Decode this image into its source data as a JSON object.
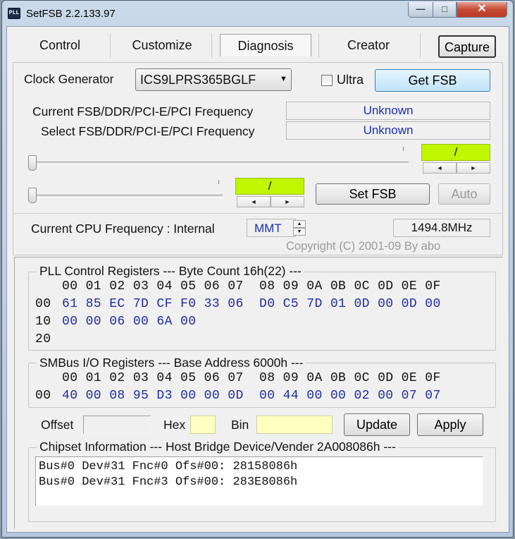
{
  "window": {
    "app_icon_text": "PLL",
    "title": "SetFSB 2.2.133.97",
    "min_glyph": "—",
    "max_glyph": "□",
    "close_glyph": "✕"
  },
  "tabs": [
    {
      "label": "Control"
    },
    {
      "label": "Customize"
    },
    {
      "label": "Diagnosis",
      "selected": true
    },
    {
      "label": "Creator"
    }
  ],
  "capture_label": "Capture",
  "clock": {
    "label": "Clock Generator",
    "selected": "ICS9LPRS365BGLF",
    "ultra_label": "Ultra",
    "ultra_checked": false,
    "get_fsb_label": "Get FSB"
  },
  "freq": {
    "current_label": "Current FSB/DDR/PCI-E/PCI Frequency",
    "current_value": "Unknown",
    "select_label": "Select FSB/DDR/PCI-E/PCI Frequency",
    "select_value": "Unknown"
  },
  "slider1": {
    "value_text": "/",
    "level": 0
  },
  "slider2": {
    "value_text": "/",
    "level": 0
  },
  "spin_left": "◄",
  "spin_right": "►",
  "set_fsb_label": "Set FSB",
  "auto_label": "Auto",
  "cpu": {
    "label": "Current CPU Frequency : Internal",
    "source": "MMT",
    "value": "1494.8MHz"
  },
  "copyright": "Copyright (C) 2001-09 By abo",
  "pll": {
    "header": "PLL Control Registers  --- Byte Count 16h(22) ---",
    "col_header": "00 01 02 03 04 05 06 07  08 09 0A 0B 0C 0D 0E 0F",
    "rows": [
      {
        "addr": "00",
        "bytes": "61 85 EC 7D CF F0 33 06  D0 C5 7D 01 0D 00 0D 00"
      },
      {
        "addr": "10",
        "bytes": "00 00 06 00 6A 00"
      },
      {
        "addr": "20",
        "bytes": ""
      }
    ]
  },
  "smbus": {
    "header": "SMBus I/O Registers  --- Base Address 6000h ---",
    "col_header": "00 01 02 03 04 05 06 07  08 09 0A 0B 0C 0D 0E 0F",
    "rows": [
      {
        "addr": "00",
        "bytes": "40 00 08 95 D3 00 00 0D  00 44 00 00 02 00 07 07"
      }
    ]
  },
  "edit": {
    "offset_label": "Offset",
    "offset_value": "",
    "hex_label": "Hex",
    "hex_value": "",
    "bin_label": "Bin",
    "bin_value": "",
    "update_label": "Update",
    "apply_label": "Apply"
  },
  "chipset": {
    "header": "Chipset Information  --- Host Bridge Device/Vender 2A008086h ---",
    "lines": [
      "Bus#0 Dev#31 Fnc#0 Ofs#00: 28158086h",
      "Bus#0 Dev#31 Fnc#3 Ofs#00: 283E8086h"
    ]
  }
}
